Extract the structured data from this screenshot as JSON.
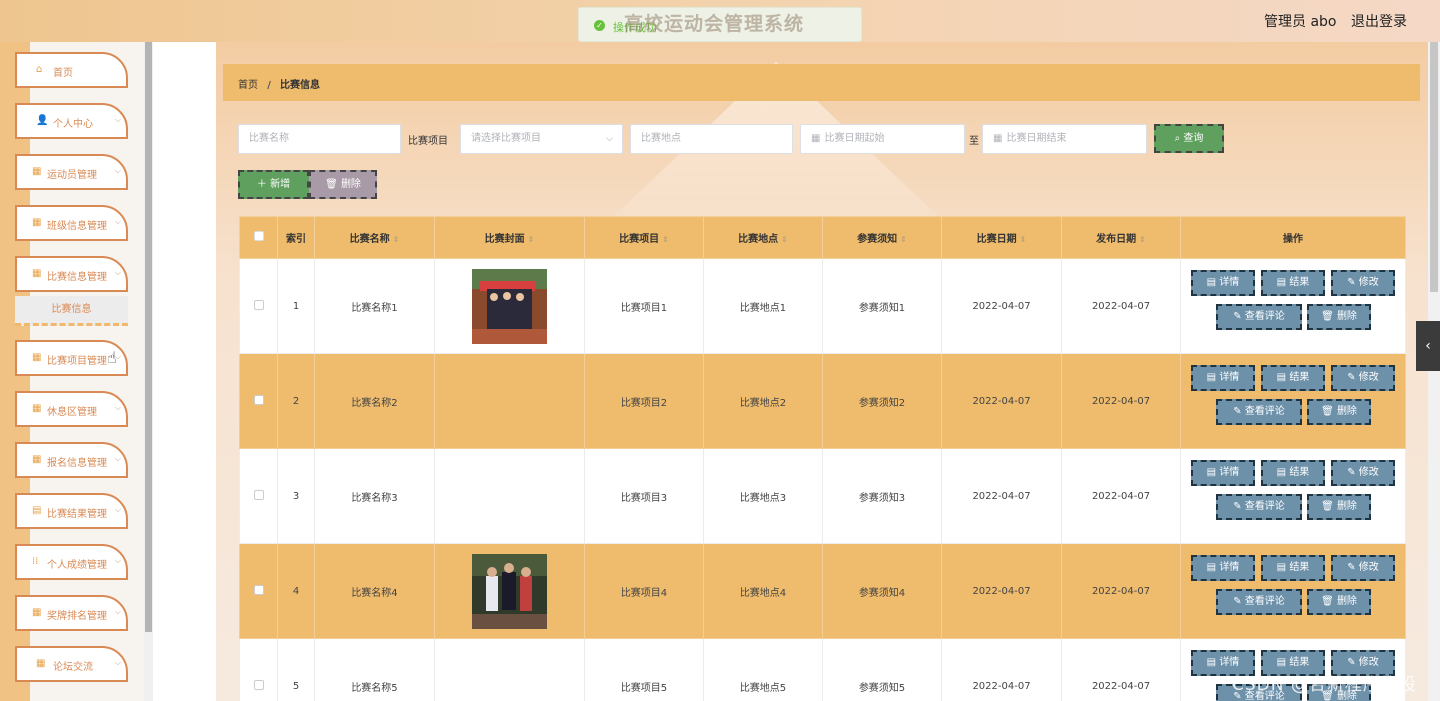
{
  "header": {
    "toast": "操作成功",
    "title": "高校运动会管理系统",
    "admin": "管理员 abo",
    "logout": "退出登录"
  },
  "sidebar": {
    "items": [
      {
        "icon": "home-icon",
        "label": "首页"
      },
      {
        "icon": "user-icon",
        "label": "个人中心"
      },
      {
        "icon": "grid-icon",
        "label": "运动员管理"
      },
      {
        "icon": "grid-icon",
        "label": "班级信息管理"
      },
      {
        "icon": "grid-icon",
        "label": "比赛信息管理"
      },
      {
        "icon": "grid-icon",
        "label": "比赛项目管理"
      },
      {
        "icon": "grid-icon",
        "label": "休息区管理"
      },
      {
        "icon": "grid-icon",
        "label": "报名信息管理"
      },
      {
        "icon": "clipboard-icon",
        "label": "比赛结果管理"
      },
      {
        "icon": "grid-dots-icon",
        "label": "个人成绩管理"
      },
      {
        "icon": "grid-icon",
        "label": "奖牌排名管理"
      },
      {
        "icon": "grid-icon",
        "label": "论坛交流"
      }
    ],
    "submenu_label": "比赛信息"
  },
  "breadcrumb": {
    "home": "首页",
    "separator": "/",
    "current": "比赛信息"
  },
  "filters": {
    "name_placeholder": "比赛名称",
    "project_label": "比赛项目",
    "project_placeholder": "请选择比赛项目",
    "location_placeholder": "比赛地点",
    "date_start_placeholder": "比赛日期起始",
    "to_label": "至",
    "date_end_placeholder": "比赛日期结束",
    "search_label": "查询"
  },
  "toolbar": {
    "add_label": "新增",
    "delete_label": "删除"
  },
  "table": {
    "headers": [
      "索引",
      "比赛名称",
      "比赛封面",
      "比赛项目",
      "比赛地点",
      "参赛须知",
      "比赛日期",
      "发布日期",
      "操作"
    ],
    "rows": [
      {
        "index": "1",
        "name": "比赛名称1",
        "cover": "track-team-photo",
        "project": "比赛项目1",
        "location": "比赛地点1",
        "notice": "参赛须知1",
        "date": "2022-04-07",
        "publish": "2022-04-07"
      },
      {
        "index": "2",
        "name": "比赛名称2",
        "cover": "",
        "project": "比赛项目2",
        "location": "比赛地点2",
        "notice": "参赛须知2",
        "date": "2022-04-07",
        "publish": "2022-04-07"
      },
      {
        "index": "3",
        "name": "比赛名称3",
        "cover": "",
        "project": "比赛项目3",
        "location": "比赛地点3",
        "notice": "参赛须知3",
        "date": "2022-04-07",
        "publish": "2022-04-07"
      },
      {
        "index": "4",
        "name": "比赛名称4",
        "cover": "runners-photo",
        "project": "比赛项目4",
        "location": "比赛地点4",
        "notice": "参赛须知4",
        "date": "2022-04-07",
        "publish": "2022-04-07"
      },
      {
        "index": "5",
        "name": "比赛名称5",
        "cover": "",
        "project": "比赛项目5",
        "location": "比赛地点5",
        "notice": "参赛须知5",
        "date": "2022-04-07",
        "publish": "2022-04-07"
      }
    ],
    "actions": {
      "detail": "详情",
      "result": "结果",
      "edit": "修改",
      "review": "查看评论",
      "delete": "删除"
    }
  },
  "watermark": "CSDN @合新程序毕设",
  "colors": {
    "accent": "#efbb6c",
    "menu_border": "#d98a54",
    "success": "#5fa05e",
    "action": "#6e91aa"
  }
}
